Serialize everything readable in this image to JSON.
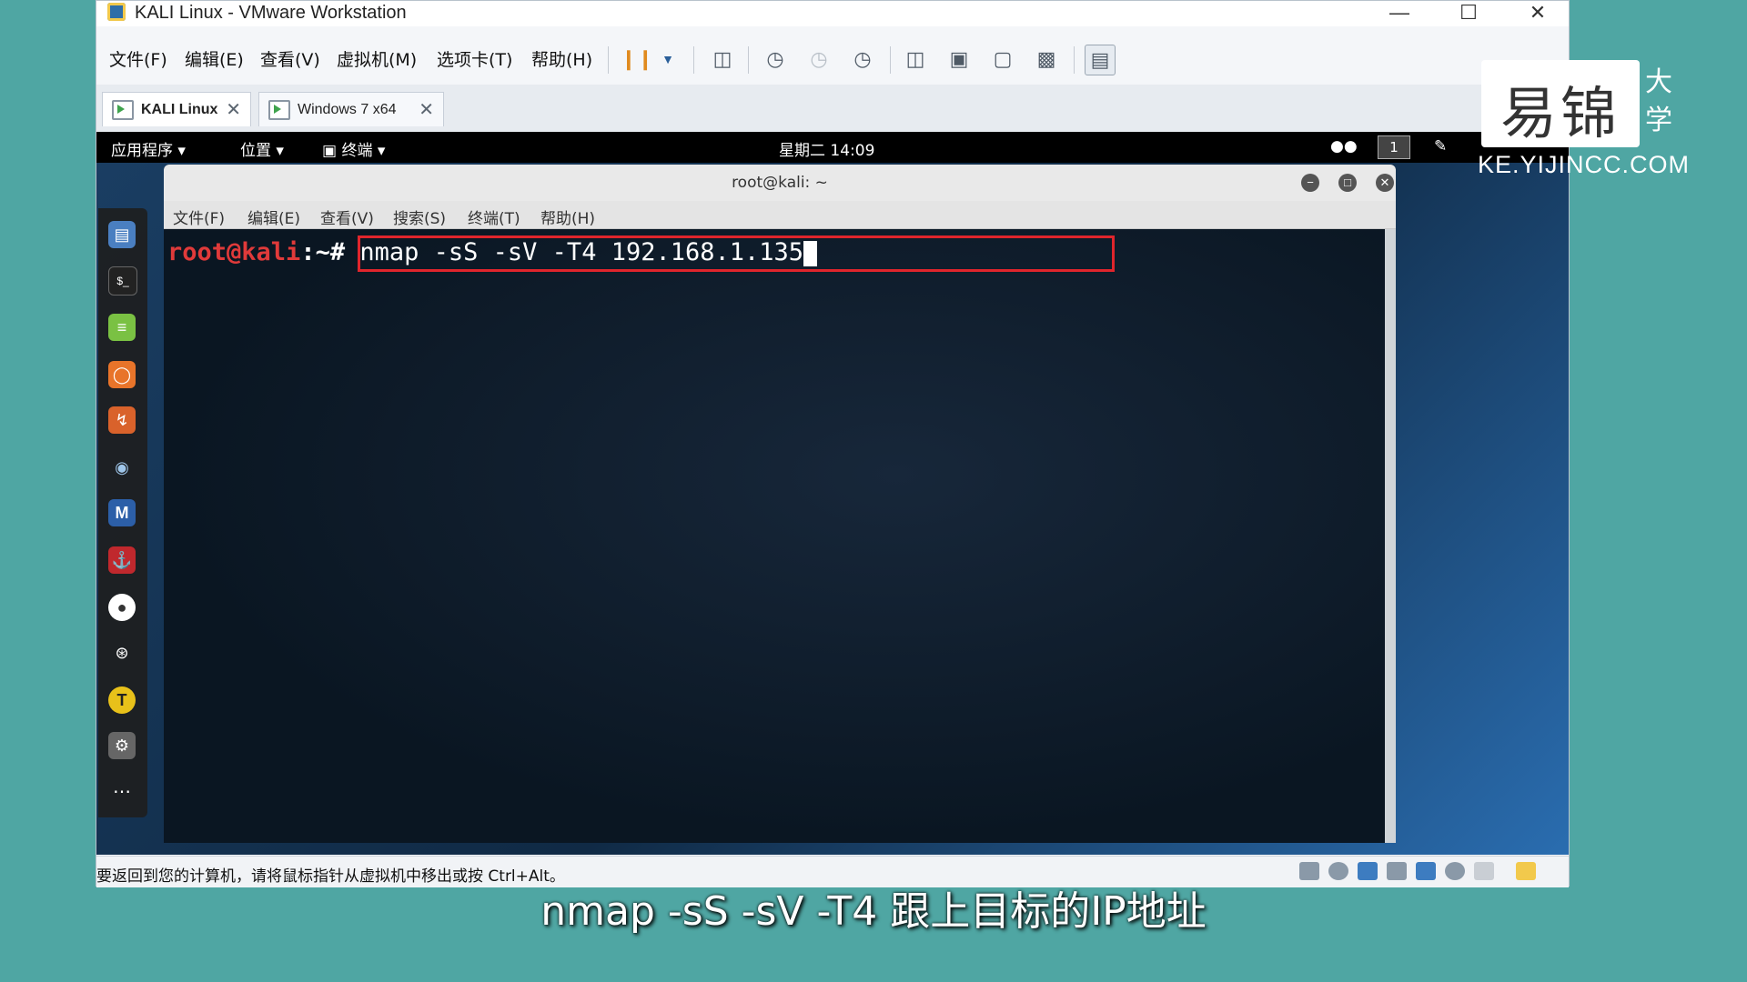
{
  "window": {
    "title": "KALI Linux - VMware Workstation"
  },
  "menubar": {
    "items": [
      "文件(F)",
      "编辑(E)",
      "查看(V)",
      "虚拟机(M)",
      "选项卡(T)",
      "帮助(H)"
    ]
  },
  "vm_tabs": [
    {
      "label": "KALI Linux",
      "active": true
    },
    {
      "label": "Windows 7 x64",
      "active": false
    }
  ],
  "gnome": {
    "apps": "应用程序",
    "places": "位置",
    "terminal": "终端",
    "clock": "星期二 14:09",
    "workspace": "1"
  },
  "terminal": {
    "title": "root@kali: ~",
    "menu": [
      "文件(F)",
      "编辑(E)",
      "查看(V)",
      "搜索(S)",
      "终端(T)",
      "帮助(H)"
    ],
    "prompt_user": "root@kali",
    "prompt_rest": ":~#",
    "command": "nmap -sS -sV -T4 192.168.1.135"
  },
  "status": {
    "text": "要返回到您的计算机，请将鼠标指针从虚拟机中移出或按 Ctrl+Alt。"
  },
  "watermark": {
    "logo": "易锦",
    "side": "大学",
    "url": "KE.YIJINCC.COM"
  },
  "subtitle": "nmap -sS -sV -T4 跟上目标的IP地址",
  "colors": {
    "accent_red": "#e0252c",
    "prompt_red": "#e03a3a",
    "background": "#4fa6a3"
  }
}
